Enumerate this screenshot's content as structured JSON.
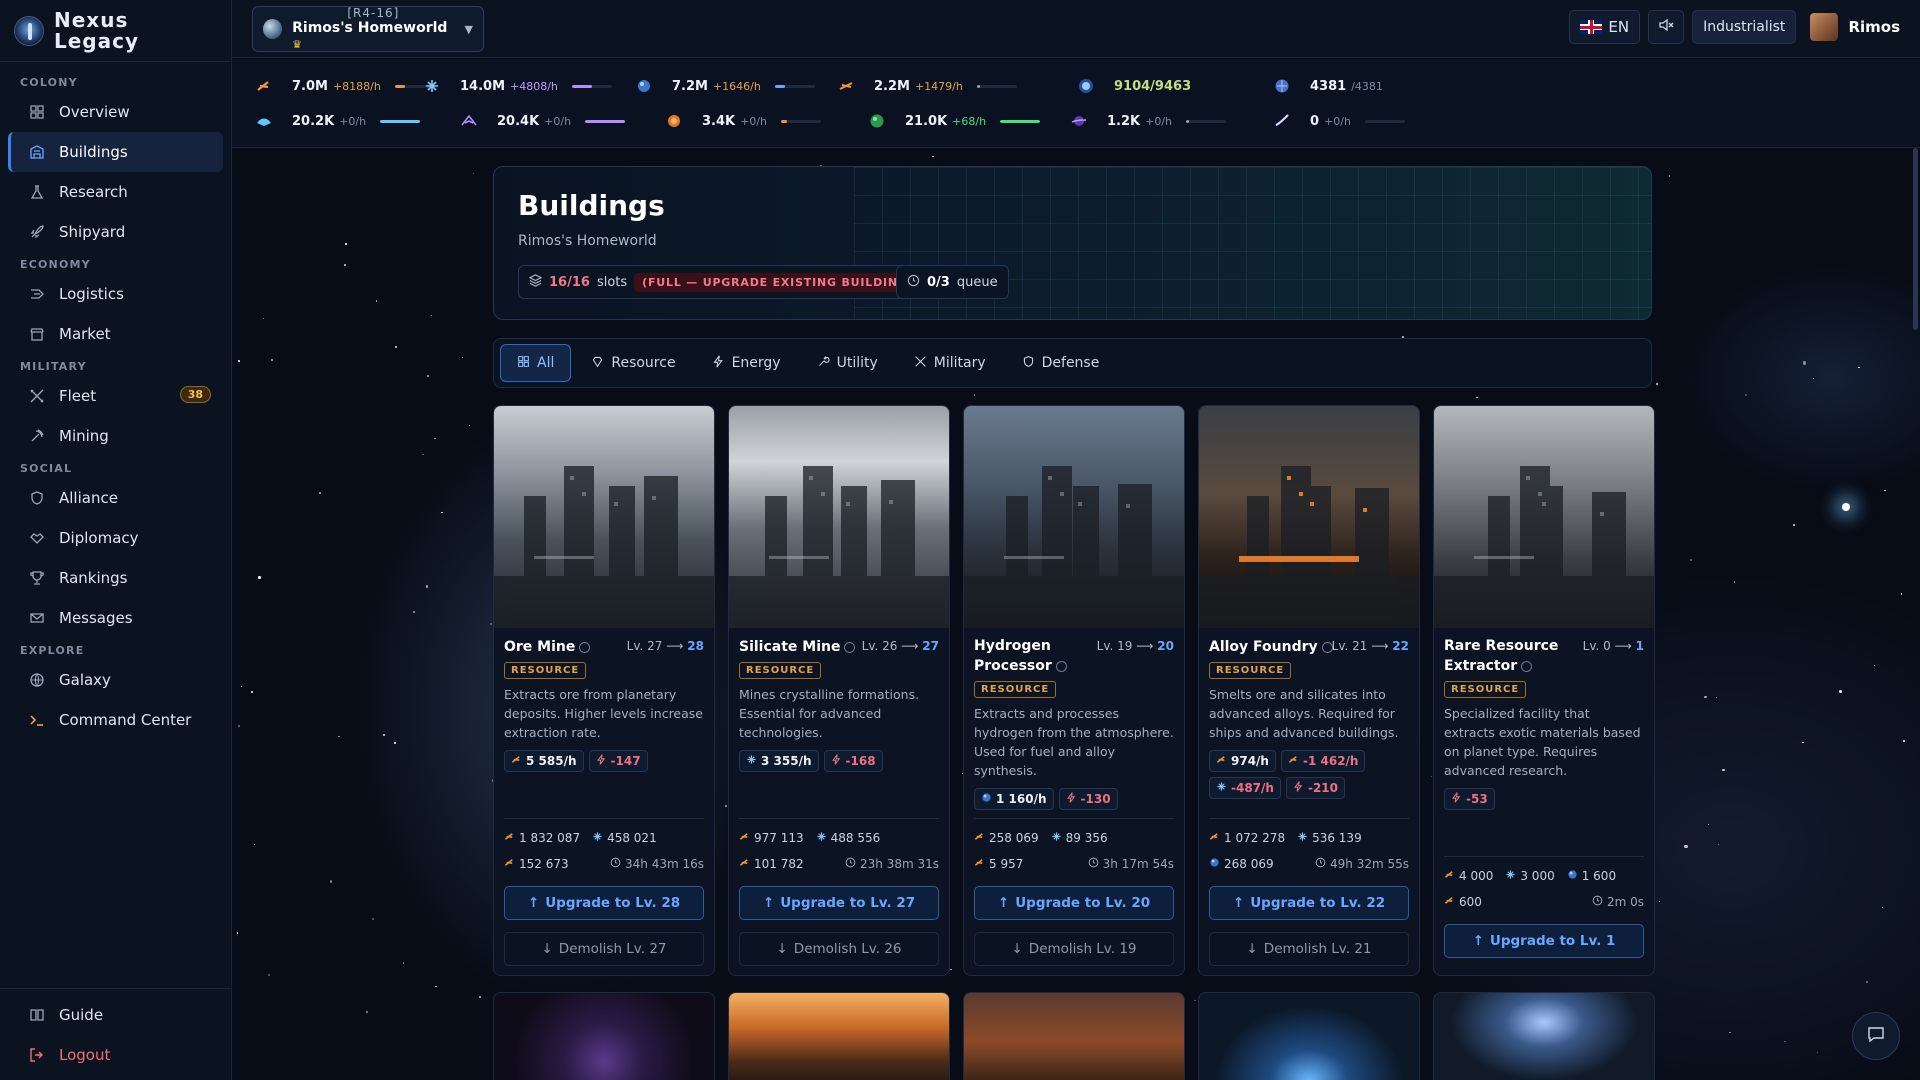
{
  "app": {
    "name_line1": "Nexus",
    "name_line2": "Legacy"
  },
  "sidebar": {
    "sections": [
      {
        "label": "COLONY",
        "items": [
          {
            "label": "Overview"
          },
          {
            "label": "Buildings",
            "active": true
          },
          {
            "label": "Research"
          },
          {
            "label": "Shipyard"
          }
        ]
      },
      {
        "label": "ECONOMY",
        "items": [
          {
            "label": "Logistics"
          },
          {
            "label": "Market"
          }
        ]
      },
      {
        "label": "MILITARY",
        "items": [
          {
            "label": "Fleet",
            "badge": "38"
          },
          {
            "label": "Mining"
          }
        ]
      },
      {
        "label": "SOCIAL",
        "items": [
          {
            "label": "Alliance"
          },
          {
            "label": "Diplomacy"
          },
          {
            "label": "Rankings"
          },
          {
            "label": "Messages"
          }
        ]
      },
      {
        "label": "EXPLORE",
        "items": [
          {
            "label": "Galaxy"
          },
          {
            "label": "Command Center"
          }
        ]
      }
    ],
    "footer": {
      "guide": "Guide",
      "logout": "Logout"
    }
  },
  "topbar": {
    "planet_coord": "[R4-16]",
    "planet_name": "Rimos's Homeworld",
    "language": "EN",
    "rank": "Industrialist",
    "username": "Rimos"
  },
  "resources": [
    {
      "value": "7.0M",
      "rate": "+8188/h",
      "color": "#f0933a",
      "fill": 0.25
    },
    {
      "value": "14.0M",
      "rate": "+4808/h",
      "color": "#b48cff",
      "fill": 0.5
    },
    {
      "value": "7.2M",
      "rate": "+1646/h",
      "color": "#60a8ff",
      "fill": 0.25
    },
    {
      "value": "2.2M",
      "rate": "+1479/h",
      "color": "#9aa5b7",
      "fill": 0.08
    },
    {
      "value": "9104/9463",
      "rate": "",
      "color": "#8fd0ff",
      "fill": 0
    },
    {
      "value": "4381",
      "rate": "/4381",
      "color": "#60a8ff",
      "fill": 0
    },
    {
      "value": "20.2K",
      "rate": "+0/h",
      "color": "#60c8ff",
      "fill": 1
    },
    {
      "value": "20.4K",
      "rate": "+0/h",
      "color": "#b48cff",
      "fill": 1
    },
    {
      "value": "3.4K",
      "rate": "+0/h",
      "color": "#f0933a",
      "fill": 0.15
    },
    {
      "value": "21.0K",
      "rate": "+68/h",
      "color": "#4ade80",
      "fill": 1
    },
    {
      "value": "1.2K",
      "rate": "+0/h",
      "color": "#9aa5b7",
      "fill": 0.05
    },
    {
      "value": "0",
      "rate": "+0/h",
      "color": "#9aa5b7",
      "fill": 0
    }
  ],
  "header": {
    "title": "Buildings",
    "subtitle": "Rimos's Homeworld",
    "slots_used": "16/16",
    "slots_label": "slots",
    "full_tag": "(FULL — UPGRADE EXISTING BUILDINGS)",
    "queue_count": "0/3",
    "queue_label": "queue"
  },
  "tabs": [
    {
      "label": "All",
      "active": true
    },
    {
      "label": "Resource"
    },
    {
      "label": "Energy"
    },
    {
      "label": "Utility"
    },
    {
      "label": "Military"
    },
    {
      "label": "Defense"
    }
  ],
  "buildings": [
    {
      "name": "Ore Mine",
      "lvl_from": "Lv. 27",
      "lvl_to": "28",
      "tag": "RESOURCE",
      "desc": "Extracts ore from planetary deposits. Higher levels increase extraction rate.",
      "prod": [
        {
          "icon": "ore",
          "text": "5 585/h"
        },
        {
          "icon": "energy",
          "text": "-147",
          "neg": true
        }
      ],
      "cost_row1": [
        {
          "icon": "ore",
          "text": "1 832 087"
        },
        {
          "icon": "crystal",
          "text": "458 021"
        }
      ],
      "cost_row2": [
        {
          "icon": "ore",
          "text": "152 673"
        }
      ],
      "time": "34h 43m 16s",
      "upgrade": "Upgrade to Lv. 28",
      "demolish": "Demolish Lv. 27"
    },
    {
      "name": "Silicate Mine",
      "lvl_from": "Lv. 26",
      "lvl_to": "27",
      "tag": "RESOURCE",
      "desc": "Mines crystalline formations. Essential for advanced technologies.",
      "prod": [
        {
          "icon": "crystal",
          "text": "3 355/h"
        },
        {
          "icon": "energy",
          "text": "-168",
          "neg": true
        }
      ],
      "cost_row1": [
        {
          "icon": "ore",
          "text": "977 113"
        },
        {
          "icon": "crystal",
          "text": "488 556"
        }
      ],
      "cost_row2": [
        {
          "icon": "ore",
          "text": "101 782"
        }
      ],
      "time": "23h 38m 31s",
      "upgrade": "Upgrade to Lv. 27",
      "demolish": "Demolish Lv. 26"
    },
    {
      "name": "Hydrogen Processor",
      "lvl_from": "Lv. 19",
      "lvl_to": "20",
      "tag": "RESOURCE",
      "desc": "Extracts and processes hydrogen from the atmosphere. Used for fuel and alloy synthesis.",
      "prod": [
        {
          "icon": "gas",
          "text": "1 160/h"
        },
        {
          "icon": "energy",
          "text": "-130",
          "neg": true
        }
      ],
      "cost_row1": [
        {
          "icon": "ore",
          "text": "258 069"
        },
        {
          "icon": "crystal",
          "text": "89 356"
        }
      ],
      "cost_row2": [
        {
          "icon": "ore",
          "text": "5 957"
        }
      ],
      "time": "3h 17m 54s",
      "upgrade": "Upgrade to Lv. 20",
      "demolish": "Demolish Lv. 19"
    },
    {
      "name": "Alloy Foundry",
      "lvl_from": "Lv. 21",
      "lvl_to": "22",
      "tag": "RESOURCE",
      "desc": "Smelts ore and silicates into advanced alloys. Required for ships and advanced buildings.",
      "prod": [
        {
          "icon": "ore",
          "text": "974/h"
        },
        {
          "icon": "ore",
          "text": "-1 462/h",
          "neg": true
        },
        {
          "icon": "crystal",
          "text": "-487/h",
          "neg": true
        },
        {
          "icon": "energy",
          "text": "-210",
          "neg": true
        }
      ],
      "cost_row1": [
        {
          "icon": "ore",
          "text": "1 072 278"
        },
        {
          "icon": "crystal",
          "text": "536 139"
        }
      ],
      "cost_row2": [
        {
          "icon": "gas",
          "text": "268 069"
        }
      ],
      "time": "49h 32m 55s",
      "upgrade": "Upgrade to Lv. 22",
      "demolish": "Demolish Lv. 21"
    },
    {
      "name": "Rare Resource Extractor",
      "lvl_from": "Lv. 0",
      "lvl_to": "1",
      "tag": "RESOURCE",
      "desc": "Specialized facility that extracts exotic materials based on planet type. Requires advanced research.",
      "prod": [
        {
          "icon": "energy",
          "text": "-53",
          "neg": true
        }
      ],
      "cost_row1": [
        {
          "icon": "ore",
          "text": "4 000"
        },
        {
          "icon": "crystal",
          "text": "3 000"
        },
        {
          "icon": "gas",
          "text": "1 600"
        }
      ],
      "cost_row2": [
        {
          "icon": "ore",
          "text": "600"
        }
      ],
      "time": "2m 0s",
      "upgrade": "Upgrade to Lv. 1",
      "demolish": ""
    }
  ]
}
